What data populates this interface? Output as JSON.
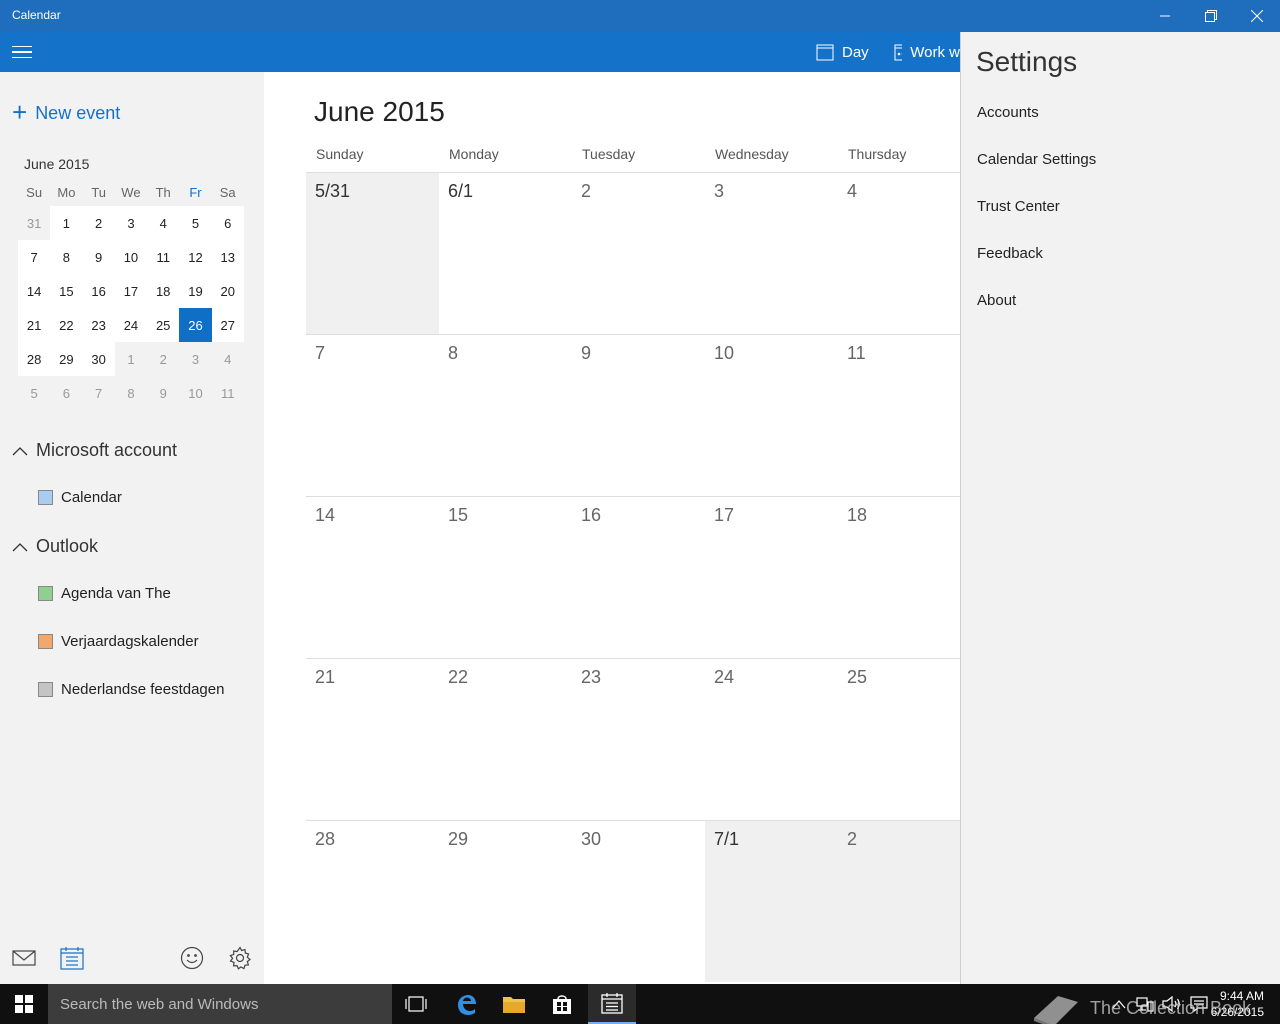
{
  "window": {
    "title": "Calendar"
  },
  "appbar": {
    "day_label": "Day",
    "work_week_label": "Work w"
  },
  "sidebar": {
    "new_event_label": "New event",
    "mini_calendar": {
      "month_label": "June 2015",
      "weekdays": [
        "Su",
        "Mo",
        "Tu",
        "We",
        "Th",
        "Fr",
        "Sa"
      ],
      "weeks": [
        [
          "31",
          "1",
          "2",
          "3",
          "4",
          "5",
          "6"
        ],
        [
          "7",
          "8",
          "9",
          "10",
          "11",
          "12",
          "13"
        ],
        [
          "14",
          "15",
          "16",
          "17",
          "18",
          "19",
          "20"
        ],
        [
          "21",
          "22",
          "23",
          "24",
          "25",
          "26",
          "27"
        ],
        [
          "28",
          "29",
          "30",
          "1",
          "2",
          "3",
          "4"
        ],
        [
          "5",
          "6",
          "7",
          "8",
          "9",
          "10",
          "11"
        ]
      ],
      "selected_day": "26"
    },
    "accounts": [
      {
        "name": "Microsoft account",
        "calendars": [
          {
            "name": "Calendar",
            "color": "#a9cdf2"
          }
        ]
      },
      {
        "name": "Outlook",
        "calendars": [
          {
            "name": "Agenda van The",
            "color": "#8fcf8f"
          },
          {
            "name": "Verjaardagskalender",
            "color": "#f4a76a"
          },
          {
            "name": "Nederlandse feestdagen",
            "color": "#c4c4c4"
          }
        ]
      }
    ]
  },
  "month_view": {
    "title": "June 2015",
    "day_headers": [
      "Sunday",
      "Monday",
      "Tuesday",
      "Wednesday",
      "Thursday"
    ],
    "weeks": [
      [
        "5/31",
        "6/1",
        "2",
        "3",
        "4"
      ],
      [
        "7",
        "8",
        "9",
        "10",
        "11"
      ],
      [
        "14",
        "15",
        "16",
        "17",
        "18"
      ],
      [
        "21",
        "22",
        "23",
        "24",
        "25"
      ],
      [
        "28",
        "29",
        "30",
        "7/1",
        "2"
      ]
    ]
  },
  "settings": {
    "title": "Settings",
    "items": [
      "Accounts",
      "Calendar Settings",
      "Trust Center",
      "Feedback",
      "About"
    ]
  },
  "taskbar": {
    "search_placeholder": "Search the web and Windows",
    "time": "9:44 AM",
    "date": "6/26/2015"
  },
  "watermark": {
    "text": "The Collection Book"
  },
  "colors": {
    "titlebar": "#1f6dbd",
    "appbar": "#1572c9",
    "accent": "#0f6fc6"
  }
}
